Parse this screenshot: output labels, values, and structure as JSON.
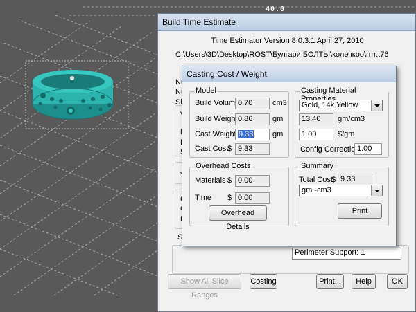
{
  "viewport": {
    "axis_label": "40.0"
  },
  "build_time": {
    "title": "Build Time Estimate",
    "version": "Time Estimator Version 8.0.3.1 April 27, 2010",
    "path": "C:\\Users\\3D\\Desktop\\ROST\\Булгари БОЛТЫ\\колечкоо\\rrrr.t76",
    "bg_labels": [
      "Nu",
      "Nu",
      "Sl",
      "V",
      "N",
      "E",
      "S",
      "J",
      "C",
      "C",
      "F",
      "S"
    ],
    "perimeter_value": "Perimeter Support: 1",
    "buttons": {
      "show_all": "Show All Slice Ranges",
      "costing": "Costing",
      "print": "Print...",
      "help": "Help",
      "ok": "OK"
    }
  },
  "casting": {
    "title": "Casting Cost / Weight",
    "model": {
      "group_label": "Model",
      "build_volume_label": "Build Volume",
      "build_volume": "0.70",
      "build_volume_unit": "cm3",
      "build_weight_label": "Build Weight",
      "build_weight": "0.86",
      "build_weight_unit": "gm",
      "cast_weight_label": "Cast Weight",
      "cast_weight": "9.33",
      "cast_weight_unit": "gm",
      "cast_cost_label": "Cast Cost",
      "cast_cost_currency": "$",
      "cast_cost": "9.33"
    },
    "material": {
      "group_label": "Casting Material Properties",
      "selected": "Gold, 14k Yellow",
      "density": "13.40",
      "density_unit": "gm/cm3",
      "price": "1.00",
      "price_unit": "$/gm",
      "config_label": "Config Correction",
      "config_value": "1.00"
    },
    "overhead": {
      "group_label": "Overhead Costs",
      "materials_label": "Materials",
      "materials_currency": "$",
      "materials": "0.00",
      "time_label": "Time",
      "time_currency": "$",
      "time": "0.00",
      "details_button": "Overhead Details"
    },
    "summary": {
      "group_label": "Summary",
      "total_label": "Total Cost",
      "total_currency": "$",
      "total": "9.33",
      "units_selected": "gm -cm3",
      "print_button": "Print"
    }
  }
}
